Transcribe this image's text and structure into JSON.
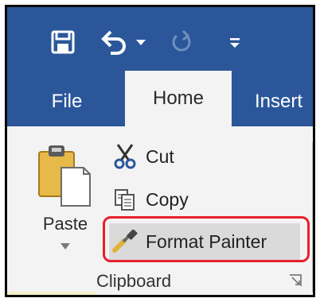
{
  "quick_access": {
    "save_icon": "save-icon",
    "undo_icon": "undo-icon",
    "redo_icon": "redo-icon",
    "customize_icon": "customize-qat-icon"
  },
  "tabs": [
    {
      "label": "File",
      "active": false
    },
    {
      "label": "Home",
      "active": true
    },
    {
      "label": "Insert",
      "active": false
    }
  ],
  "clipboard": {
    "paste_label": "Paste",
    "cut_label": "Cut",
    "copy_label": "Copy",
    "format_painter_label": "Format Painter",
    "group_label": "Clipboard"
  },
  "colors": {
    "ribbon_blue": "#2b579a",
    "ribbon_body": "#f3f3f3",
    "highlight_red": "#e8202a"
  }
}
